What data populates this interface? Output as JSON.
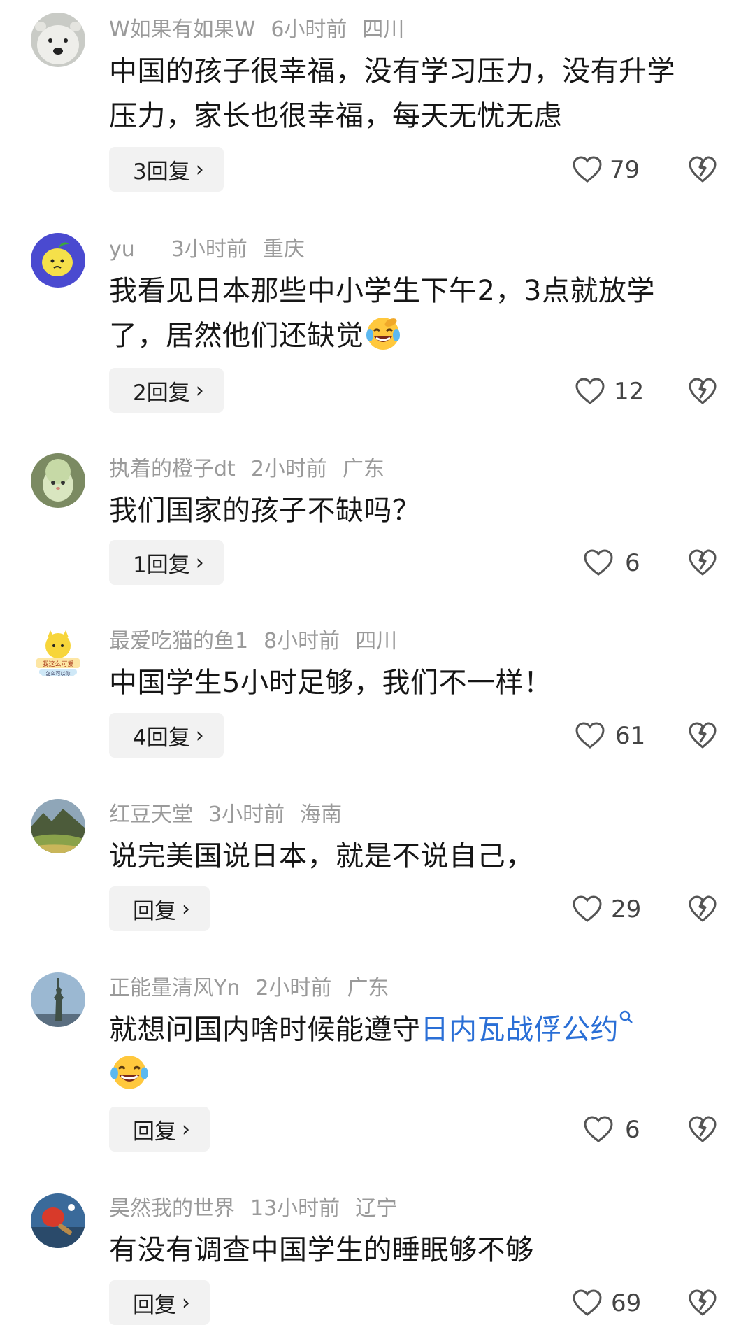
{
  "comments": [
    {
      "username": "W如果有如果W",
      "time": "6小时前",
      "location": "四川",
      "content_lines": [
        "中国的孩子很幸福，没有学习压力，没有升学",
        "压力，家长也很幸福，每天无忧无虑"
      ],
      "reply_label": "3回复",
      "likes": "79",
      "avatar": "polar-bear"
    },
    {
      "username": "yu",
      "time": "3小时前",
      "location": "重庆",
      "content_lines": [
        "我看见日本那些中小学生下午2，3点就放学",
        "了，居然他们还缺觉"
      ],
      "emoji": "crying-laughing-emoji",
      "reply_label": "2回复",
      "likes": "12",
      "avatar": "lemon-cartoon"
    },
    {
      "username": "执着的橙子dt",
      "time": "2小时前",
      "location": "广东",
      "content_lines": [
        "我们国家的孩子不缺吗？"
      ],
      "reply_label": "1回复",
      "likes": "6",
      "avatar": "green-plush-toy"
    },
    {
      "username": "最爱吃猫的鱼1",
      "time": "8小时前",
      "location": "四川",
      "content_lines": [
        "中国学生5小时足够，我们不一样！"
      ],
      "reply_label": "4回复",
      "likes": "61",
      "avatar": "yellow-cat-sticker",
      "avatar_text_1": "我这么可爱",
      "avatar_text_2": "怎么可以你"
    },
    {
      "username": "红豆天堂",
      "time": "3小时前",
      "location": "海南",
      "content_lines": [
        "说完美国说日本，就是不说自己，"
      ],
      "reply_label": "回复",
      "likes": "29",
      "avatar": "mountain-landscape"
    },
    {
      "username": "正能量清风Yn",
      "time": "2小时前",
      "location": "广东",
      "content_prefix": "就想问国内啥时候能遵守",
      "content_link": "日内瓦战俘公约",
      "emoji": "laughing-tears-emoji",
      "reply_label": "回复",
      "likes": "6",
      "avatar": "statue-of-liberty"
    },
    {
      "username": "昊然我的世界",
      "time": "13小时前",
      "location": "辽宁",
      "content_lines": [
        "有没有调查中国学生的睡眠够不够"
      ],
      "reply_label": "回复",
      "likes": "69",
      "avatar": "ping-pong-paddle"
    }
  ]
}
